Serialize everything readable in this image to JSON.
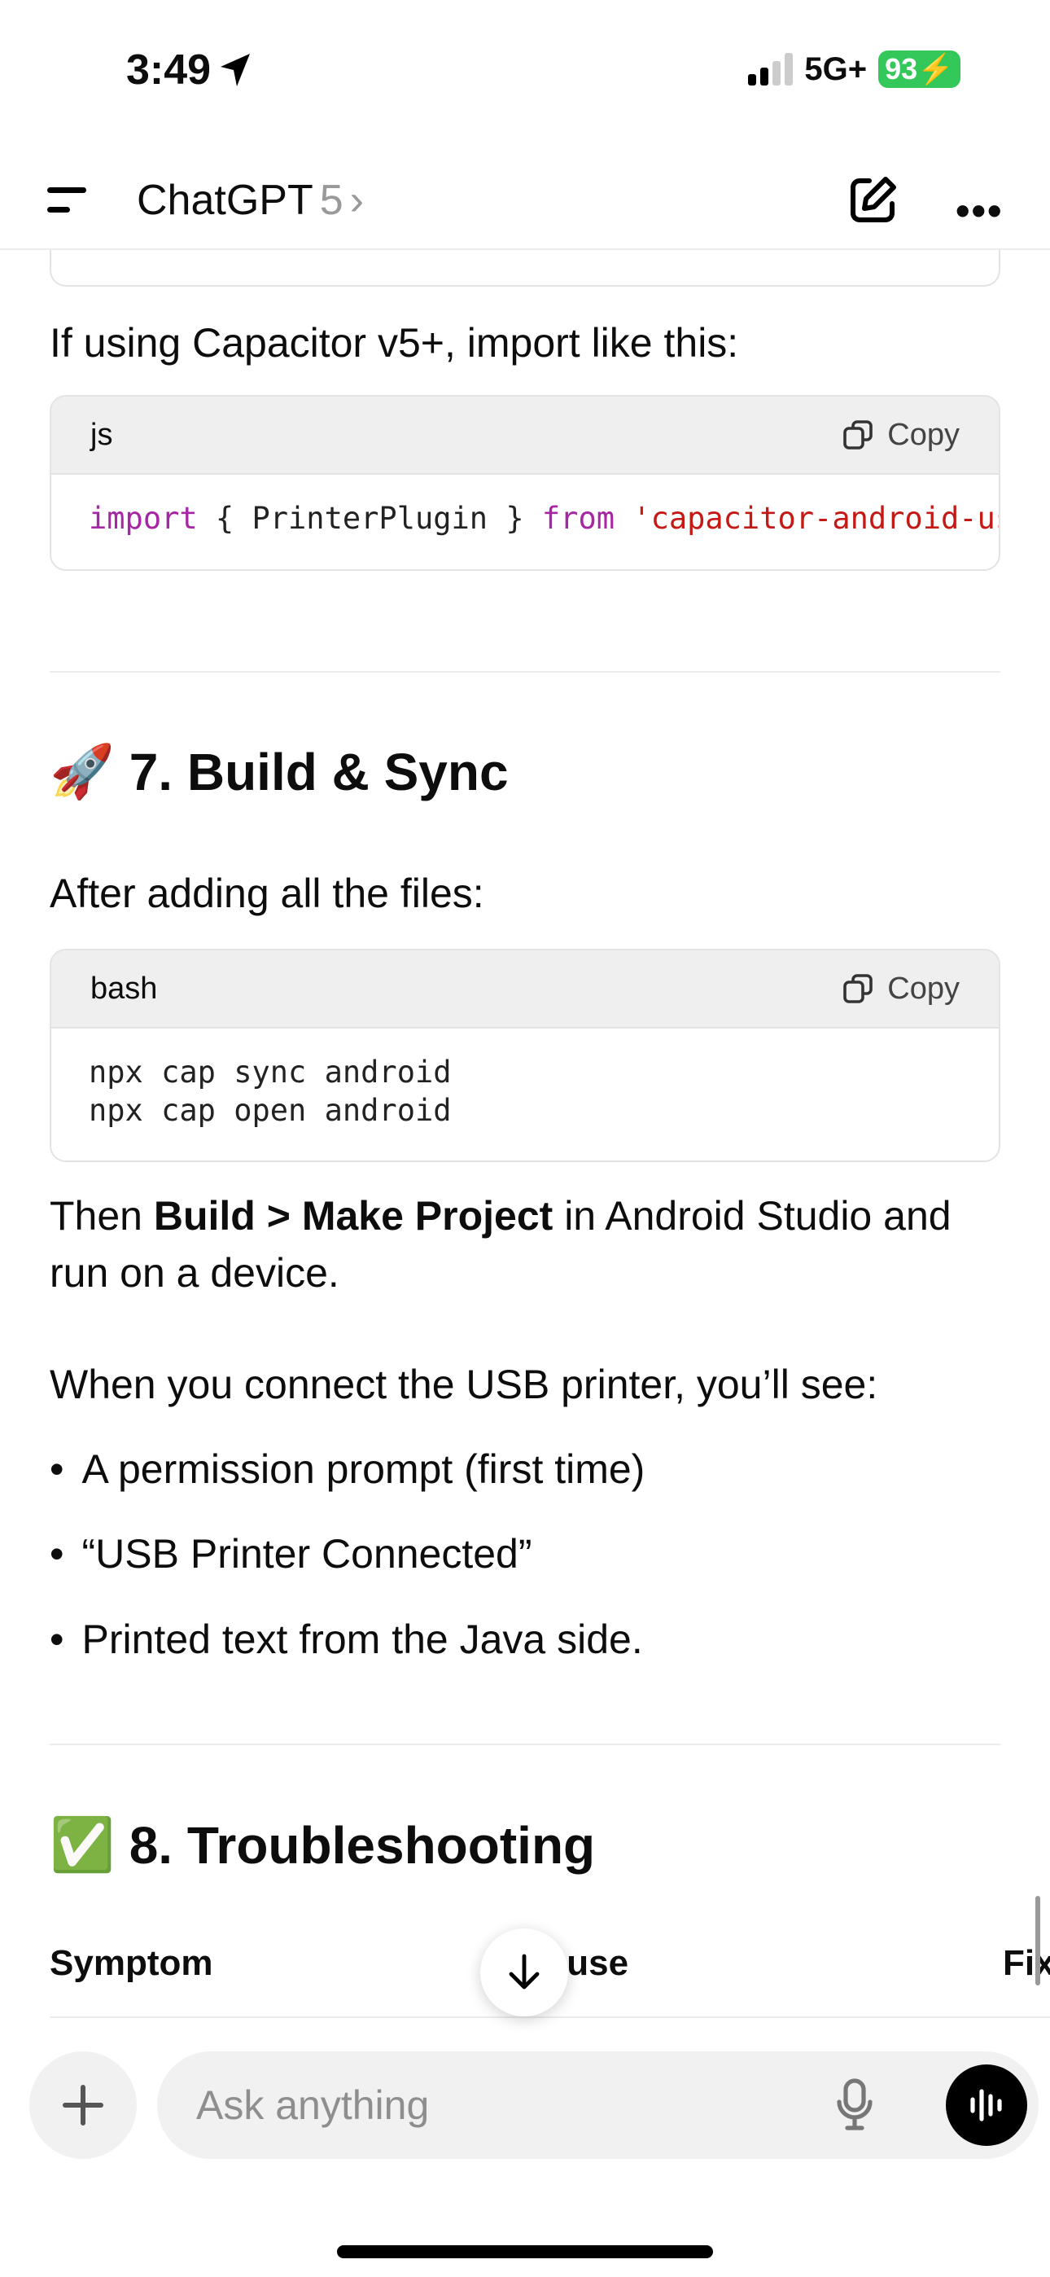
{
  "status_bar": {
    "time": "3:49",
    "network": "5G+",
    "battery": "93"
  },
  "header": {
    "title": "ChatGPT",
    "version": "5",
    "chevron": "›"
  },
  "content": {
    "capacitor_note": "If using Capacitor v5+, import like this:",
    "code_js": {
      "lang": "js",
      "copy_label": "Copy",
      "kw1": "import",
      "mid": " { PrinterPlugin } ",
      "kw2": "from",
      "str": " 'capacitor-android-usb-printer';"
    },
    "section7": {
      "emoji": "🚀",
      "title": "7. Build & Sync"
    },
    "after_files": "After adding all the files:",
    "code_bash": {
      "lang": "bash",
      "copy_label": "Copy",
      "lines": [
        "npx cap sync android",
        "npx cap open android"
      ]
    },
    "then_prefix": "Then ",
    "then_bold": "Build > Make Project",
    "then_suffix": " in Android Studio and run on a device.",
    "when_connect": "When you connect the USB printer, you’ll see:",
    "bullets": [
      "A permission prompt (first time)",
      "“USB Printer Connected”",
      "Printed text from the Java side."
    ],
    "section8": {
      "emoji": "✅",
      "title": "8. Troubleshooting"
    },
    "table_headers": [
      "Symptom",
      "Cause",
      "Fix"
    ]
  },
  "composer": {
    "placeholder": "Ask anything"
  }
}
